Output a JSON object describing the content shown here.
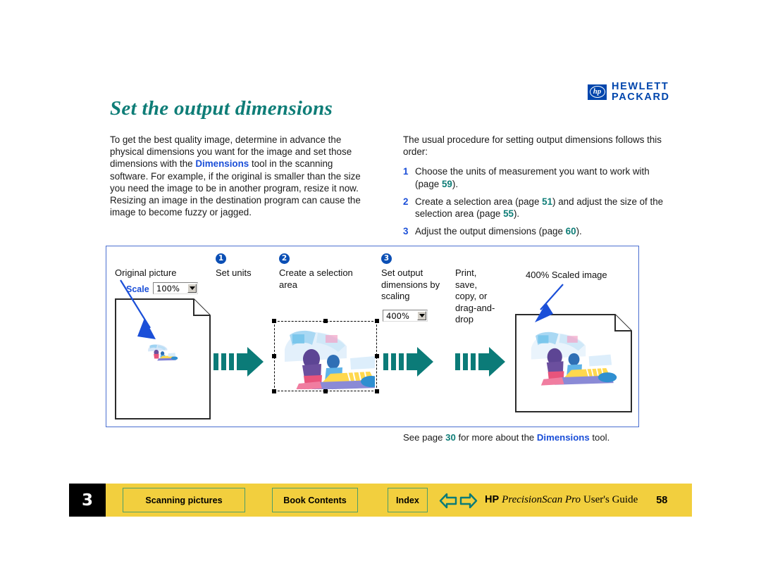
{
  "logo": {
    "mark": "hp",
    "line1": "HEWLETT",
    "line2": "PACKARD",
    "registered": "®"
  },
  "header": {
    "title": "Set the output dimensions"
  },
  "left_column": {
    "paragraph_1": "To get the best quality image, determine in advance the physical dimensions you want for the image and set those dimensions with the ",
    "dimensions_term": "Dimensions",
    "paragraph_2": " tool in the scanning software. For example, if the original is smaller than the size you need the image to be in another program, resize it now. Resizing an image in the destination program can cause the image to become fuzzy or jagged."
  },
  "right_column": {
    "intro": "The usual procedure for setting output dimensions follows this order:",
    "steps": [
      {
        "number": "1",
        "text_before": "Choose the units of measurement you want to work with (page ",
        "page_ref": "59",
        "text_after": ")."
      },
      {
        "number": "2",
        "text_before": "Create a selection area (page ",
        "page_ref": "51",
        "text_mid": ") and adjust the size of the selection area (page ",
        "page_ref_2": "55",
        "text_after": ")."
      },
      {
        "number": "3",
        "text_before": "Adjust the output dimensions (page ",
        "page_ref": "60",
        "text_after": ")."
      }
    ]
  },
  "diagram": {
    "labels": {
      "original": "Original picture",
      "set_units": "Set units",
      "create_selection": "Create a selection area",
      "set_output": "Set output dimensions by scaling",
      "print_save": "Print, save, copy, or drag-and-drop",
      "scaled_image": "400% Scaled image"
    },
    "badges": [
      "1",
      "2",
      "3"
    ],
    "scale_label": "Scale",
    "scale_value": "100%",
    "output_value": "400%",
    "icons": {
      "dropdown": "chevron-down-icon",
      "transition": "teal-block-arrow-icon",
      "pointer": "blue-pointer-arrow-icon"
    }
  },
  "footnote": {
    "text_before": "See page ",
    "page_ref": "30",
    "text_mid": " for more about the ",
    "term": "Dimensions",
    "text_after": " tool."
  },
  "footer": {
    "chapter": "3",
    "buttons": [
      "Scanning pictures",
      "Book Contents",
      "Index"
    ],
    "nav": {
      "back": "back-arrow-icon",
      "forward": "forward-arrow-icon"
    },
    "guide": {
      "brand": "HP",
      "product": "PrecisionScan Pro",
      "suffix": "User's Guide"
    },
    "page_number": "58"
  },
  "colors": {
    "title_teal": "#0e7d77",
    "link_blue": "#1b4fd8",
    "hp_blue": "#0046ad",
    "footer_yellow": "#f2cf3e",
    "button_green": "#4e9e6a",
    "arrow_teal": "#0b7b78"
  }
}
